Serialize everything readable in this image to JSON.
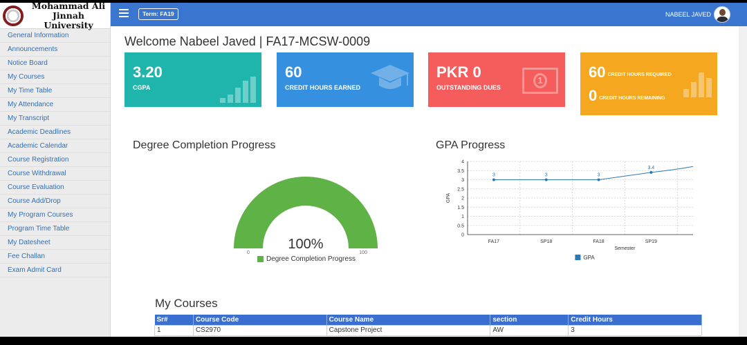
{
  "brand": {
    "line1": "Mohammad Ali Jinnah",
    "line2": "University"
  },
  "nav": [
    "General Information",
    "Announcements",
    "Notice Board",
    "My Courses",
    "My Time Table",
    "My Attendance",
    "My Transcript",
    "Academic Deadlines",
    "Academic Calendar",
    "Course Registration",
    "Course Withdrawal",
    "Course Evaluation",
    "Course Add/Drop",
    "My Program Courses",
    "Program Time Table",
    "My Datesheet",
    "Fee Challan",
    "Exam Admit Card"
  ],
  "topbar": {
    "term": "Term: FA19",
    "user": "NABEEL JAVED"
  },
  "welcome": "Welcome Nabeel Javed | FA17-MCSW-0009",
  "cards": {
    "cgpa": {
      "value": "3.20",
      "label": "CGPA"
    },
    "credits": {
      "value": "60",
      "label": "CREDIT HOURS EARNED"
    },
    "dues": {
      "value": "PKR 0",
      "label": "OUTSTANDING DUES"
    },
    "required": {
      "value": "60",
      "label": "CREDIT HOURS REQUIRED",
      "value2": "0",
      "label2": "CREDIT HOURS REMAINING"
    }
  },
  "colors": {
    "teal": "#1fb5ac",
    "blue": "#3590df",
    "red": "#f55d5d",
    "orange": "#f4a71f",
    "gauge": "#5fb245",
    "gpa_line": "#2a78b3"
  },
  "degree_section": {
    "title": "Degree Completion Progress"
  },
  "gpa_section": {
    "title": "GPA Progress"
  },
  "chart_data": [
    {
      "type": "gauge",
      "value": 100,
      "min": 0,
      "max": 100,
      "center_label": "100%",
      "min_label": "0",
      "max_label": "100",
      "legend": "Degree Completion Progress"
    },
    {
      "type": "line",
      "categories": [
        "FA17",
        "SP18",
        "FA18",
        "SP19"
      ],
      "series": [
        {
          "name": "GPA",
          "values": [
            3,
            3,
            3,
            3.4
          ]
        }
      ],
      "data_labels": [
        "3",
        "3",
        "3",
        "3.4"
      ],
      "ylabel": "GPA",
      "xlabel": "Semester",
      "ylim": [
        0,
        4
      ],
      "yticks": [
        "0",
        "0.5",
        "1",
        "1.5",
        "2",
        "2.5",
        "3",
        "3.5",
        "4"
      ],
      "grid": true,
      "legend": "bottom"
    }
  ],
  "courses": {
    "title": "My Courses",
    "headers": [
      "Sr#",
      "Course Code",
      "Course Name",
      "section",
      "Credit Hours"
    ],
    "rows": [
      [
        "1",
        "CS2970",
        "Capstone Project",
        "AW",
        "3"
      ]
    ]
  }
}
